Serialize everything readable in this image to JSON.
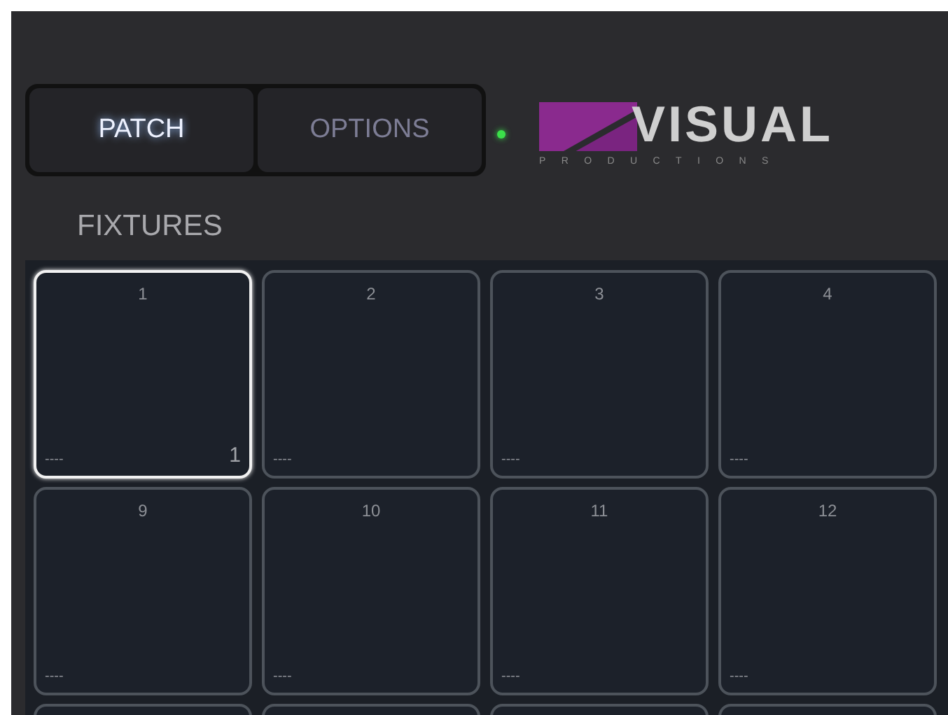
{
  "tabs": [
    {
      "label": "PATCH",
      "selected": true
    },
    {
      "label": "OPTIONS",
      "selected": false
    }
  ],
  "status_led": {
    "on": true
  },
  "logo": {
    "name": "VISUAL",
    "tagline": "PRODUCTIONS"
  },
  "section_title": "FIXTURES",
  "fixtures": [
    {
      "number": "1",
      "label": "----",
      "address": "1",
      "selected": true
    },
    {
      "number": "2",
      "label": "----",
      "selected": false
    },
    {
      "number": "3",
      "label": "----",
      "selected": false
    },
    {
      "number": "4",
      "label": "----",
      "selected": false
    },
    {
      "number": "9",
      "label": "----",
      "selected": false
    },
    {
      "number": "10",
      "label": "----",
      "selected": false
    },
    {
      "number": "11",
      "label": "----",
      "selected": false
    },
    {
      "number": "12",
      "label": "----",
      "selected": false
    }
  ]
}
